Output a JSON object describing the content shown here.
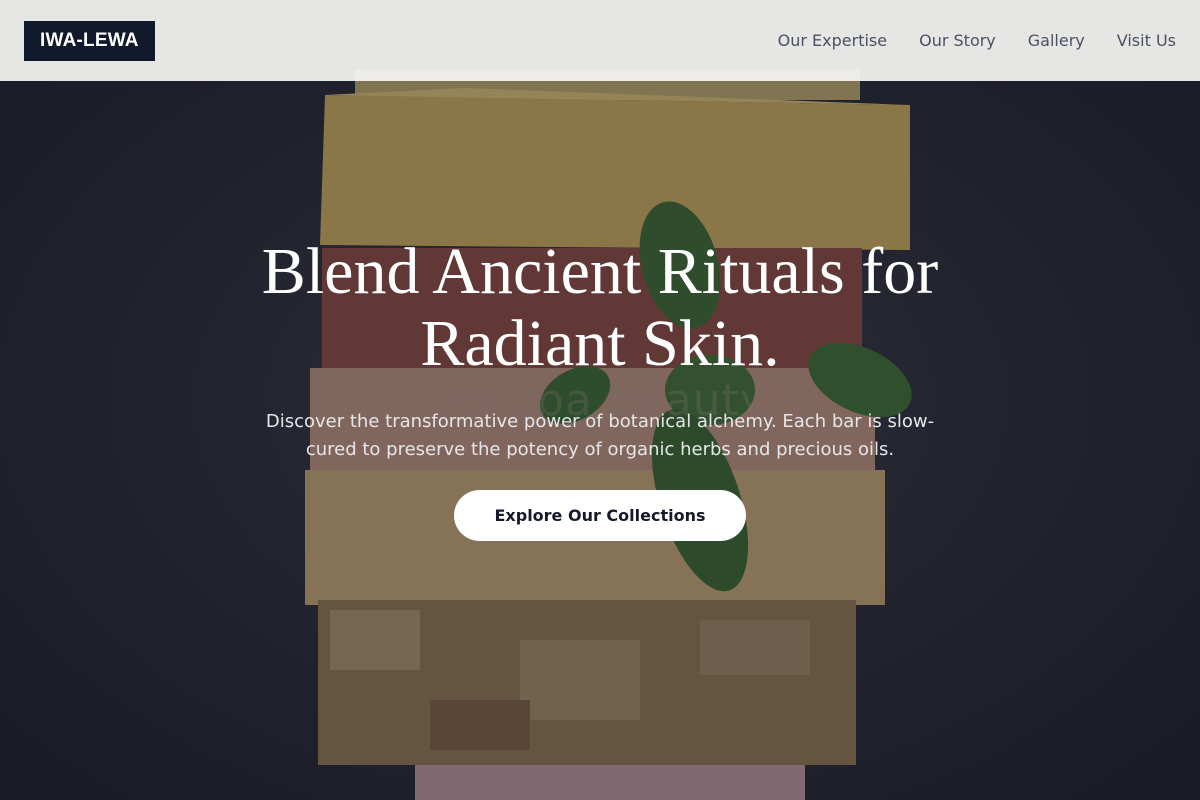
{
  "header": {
    "logo": "IWA-LEWA",
    "nav": [
      {
        "label": "Our Expertise"
      },
      {
        "label": "Our Story"
      },
      {
        "label": "Gallery"
      },
      {
        "label": "Visit Us"
      }
    ]
  },
  "hero": {
    "title": "Blend Ancient Rituals for Radiant Skin.",
    "subtitle": "Discover the transformative power of botanical alchemy. Each bar is slow-cured to preserve the potency of organic herbs and precious oils.",
    "cta_label": "Explore Our Collections",
    "watermark": "yoruba beauty"
  },
  "colors": {
    "logo_bg": "#111a2c",
    "nav_text": "#4a5163",
    "cta_bg": "#ffffff",
    "cta_text": "#141a2b"
  }
}
